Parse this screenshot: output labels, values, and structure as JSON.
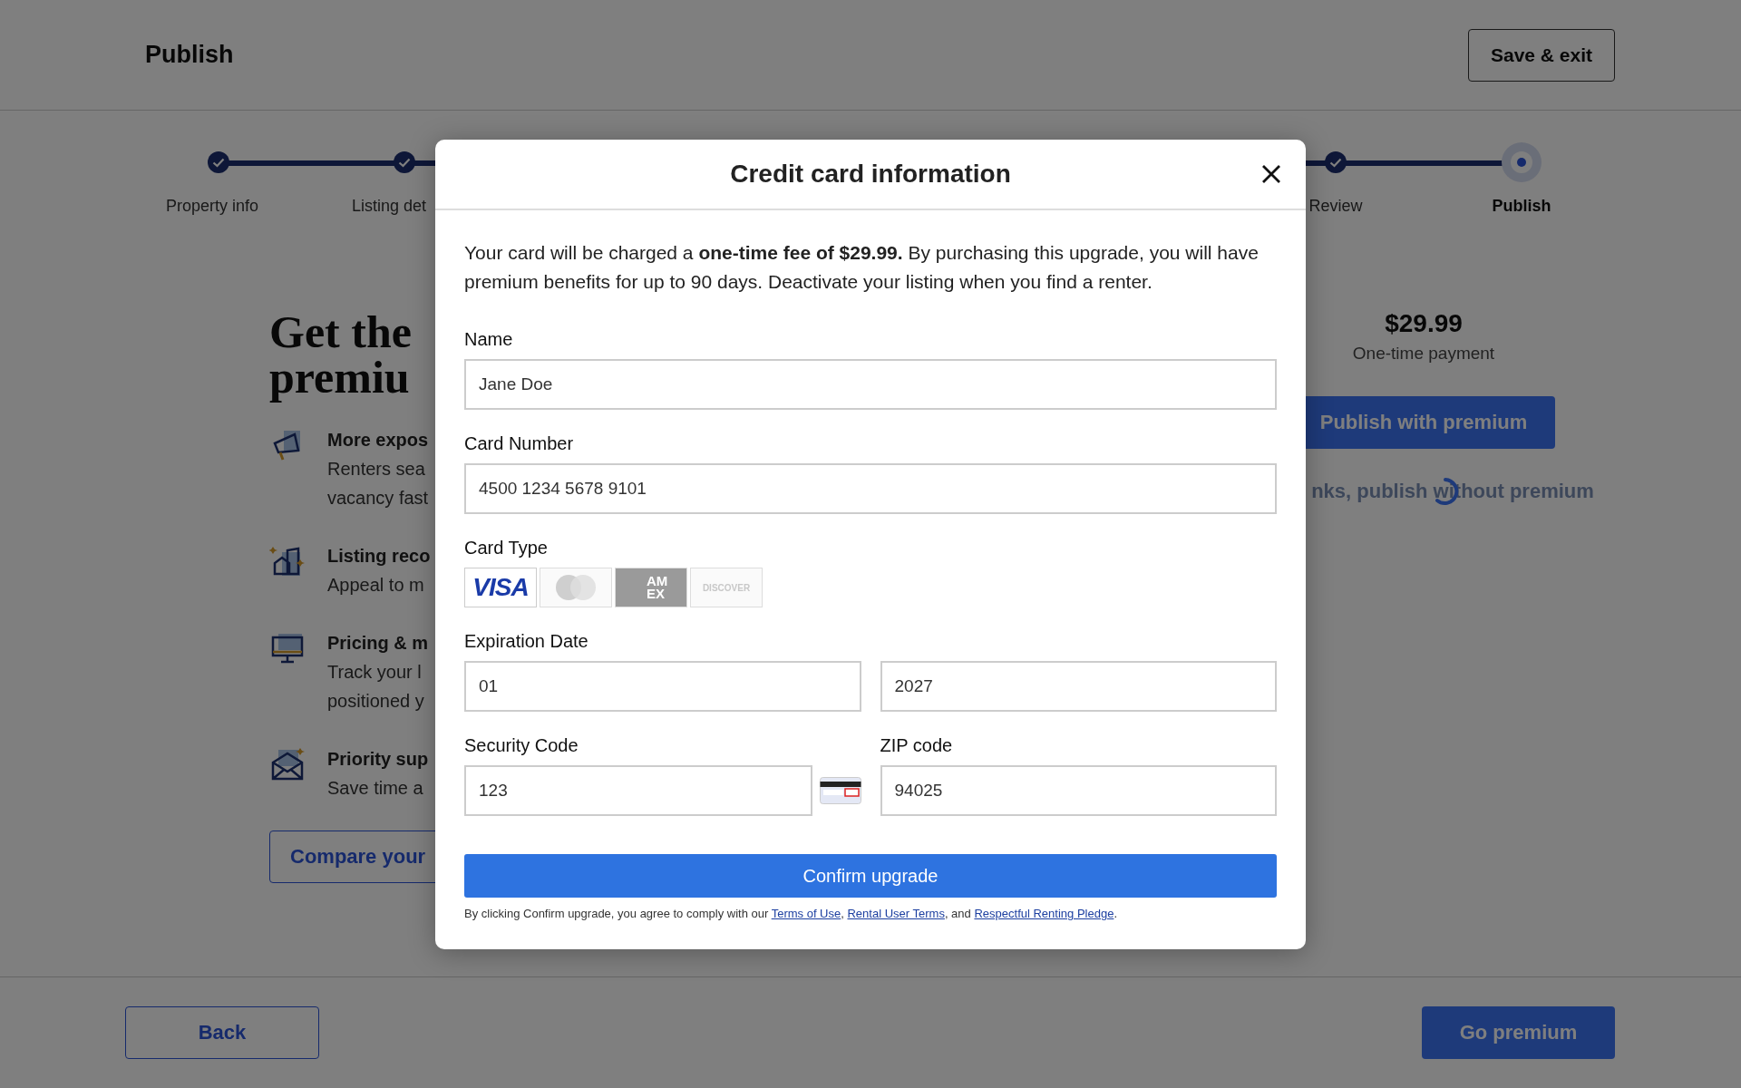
{
  "header": {
    "title": "Publish",
    "save_button": "Save & exit"
  },
  "steps": [
    {
      "label": "Property info",
      "current": false
    },
    {
      "label": "Listing det",
      "current": false
    },
    {
      "label": "Review",
      "current": false
    },
    {
      "label": "Publish",
      "current": true
    }
  ],
  "promo": {
    "heading_lines": [
      "Get the",
      "premiu"
    ],
    "features": [
      {
        "kind": "megaphone",
        "title": "More expos",
        "lines": [
          "Renters sea",
          "vacancy fast"
        ]
      },
      {
        "kind": "building",
        "title": "Listing reco",
        "lines": [
          "Appeal to m"
        ]
      },
      {
        "kind": "monitor",
        "title": "Pricing & m",
        "lines": [
          "Track your l",
          "positioned y"
        ]
      },
      {
        "kind": "envelope",
        "title": "Priority sup",
        "lines": [
          "Save time a"
        ]
      }
    ],
    "compare_button": "Compare your"
  },
  "offer": {
    "price": "$29.99",
    "price_note": "One-time payment",
    "publish_button": "Publish with premium",
    "skip_link": "nks, publish without premium",
    "loading": true
  },
  "footer": {
    "back_button": "Back",
    "next_button": "Go premium"
  },
  "modal": {
    "title": "Credit card information",
    "intro": "Your card will be charged a **one-time fee of $29.99.** By purchasing this upgrade, you will have premium benefits for up to 90 days. Deactivate your listing when you find a renter.",
    "name": {
      "label": "Name",
      "value": "Jane Doe"
    },
    "card_number": {
      "label": "Card Number",
      "value": "4500 1234 5678 9101"
    },
    "card_type": {
      "label": "Card Type",
      "cards": [
        {
          "kind": "visa",
          "label": "VISA",
          "selected": true
        },
        {
          "kind": "mastercard",
          "selected": false
        },
        {
          "kind": "amex",
          "label": "AM EX",
          "selected": false
        },
        {
          "kind": "discover",
          "label": "DISCOVER",
          "selected": false
        }
      ]
    },
    "expiration": {
      "label": "Expiration Date",
      "month": "01",
      "year": "2027"
    },
    "security_code": {
      "label": "Security Code",
      "value": "123"
    },
    "zip": {
      "label": "ZIP code",
      "value": "94025"
    },
    "confirm_button": "Confirm upgrade",
    "terms": {
      "text": "By clicking Confirm upgrade, you agree to comply with our",
      "links": [
        "Terms of Use",
        "Rental User Terms",
        "Respectful Renting Pledge"
      ],
      "separators": [
        ",",
        ", and",
        "."
      ]
    }
  }
}
